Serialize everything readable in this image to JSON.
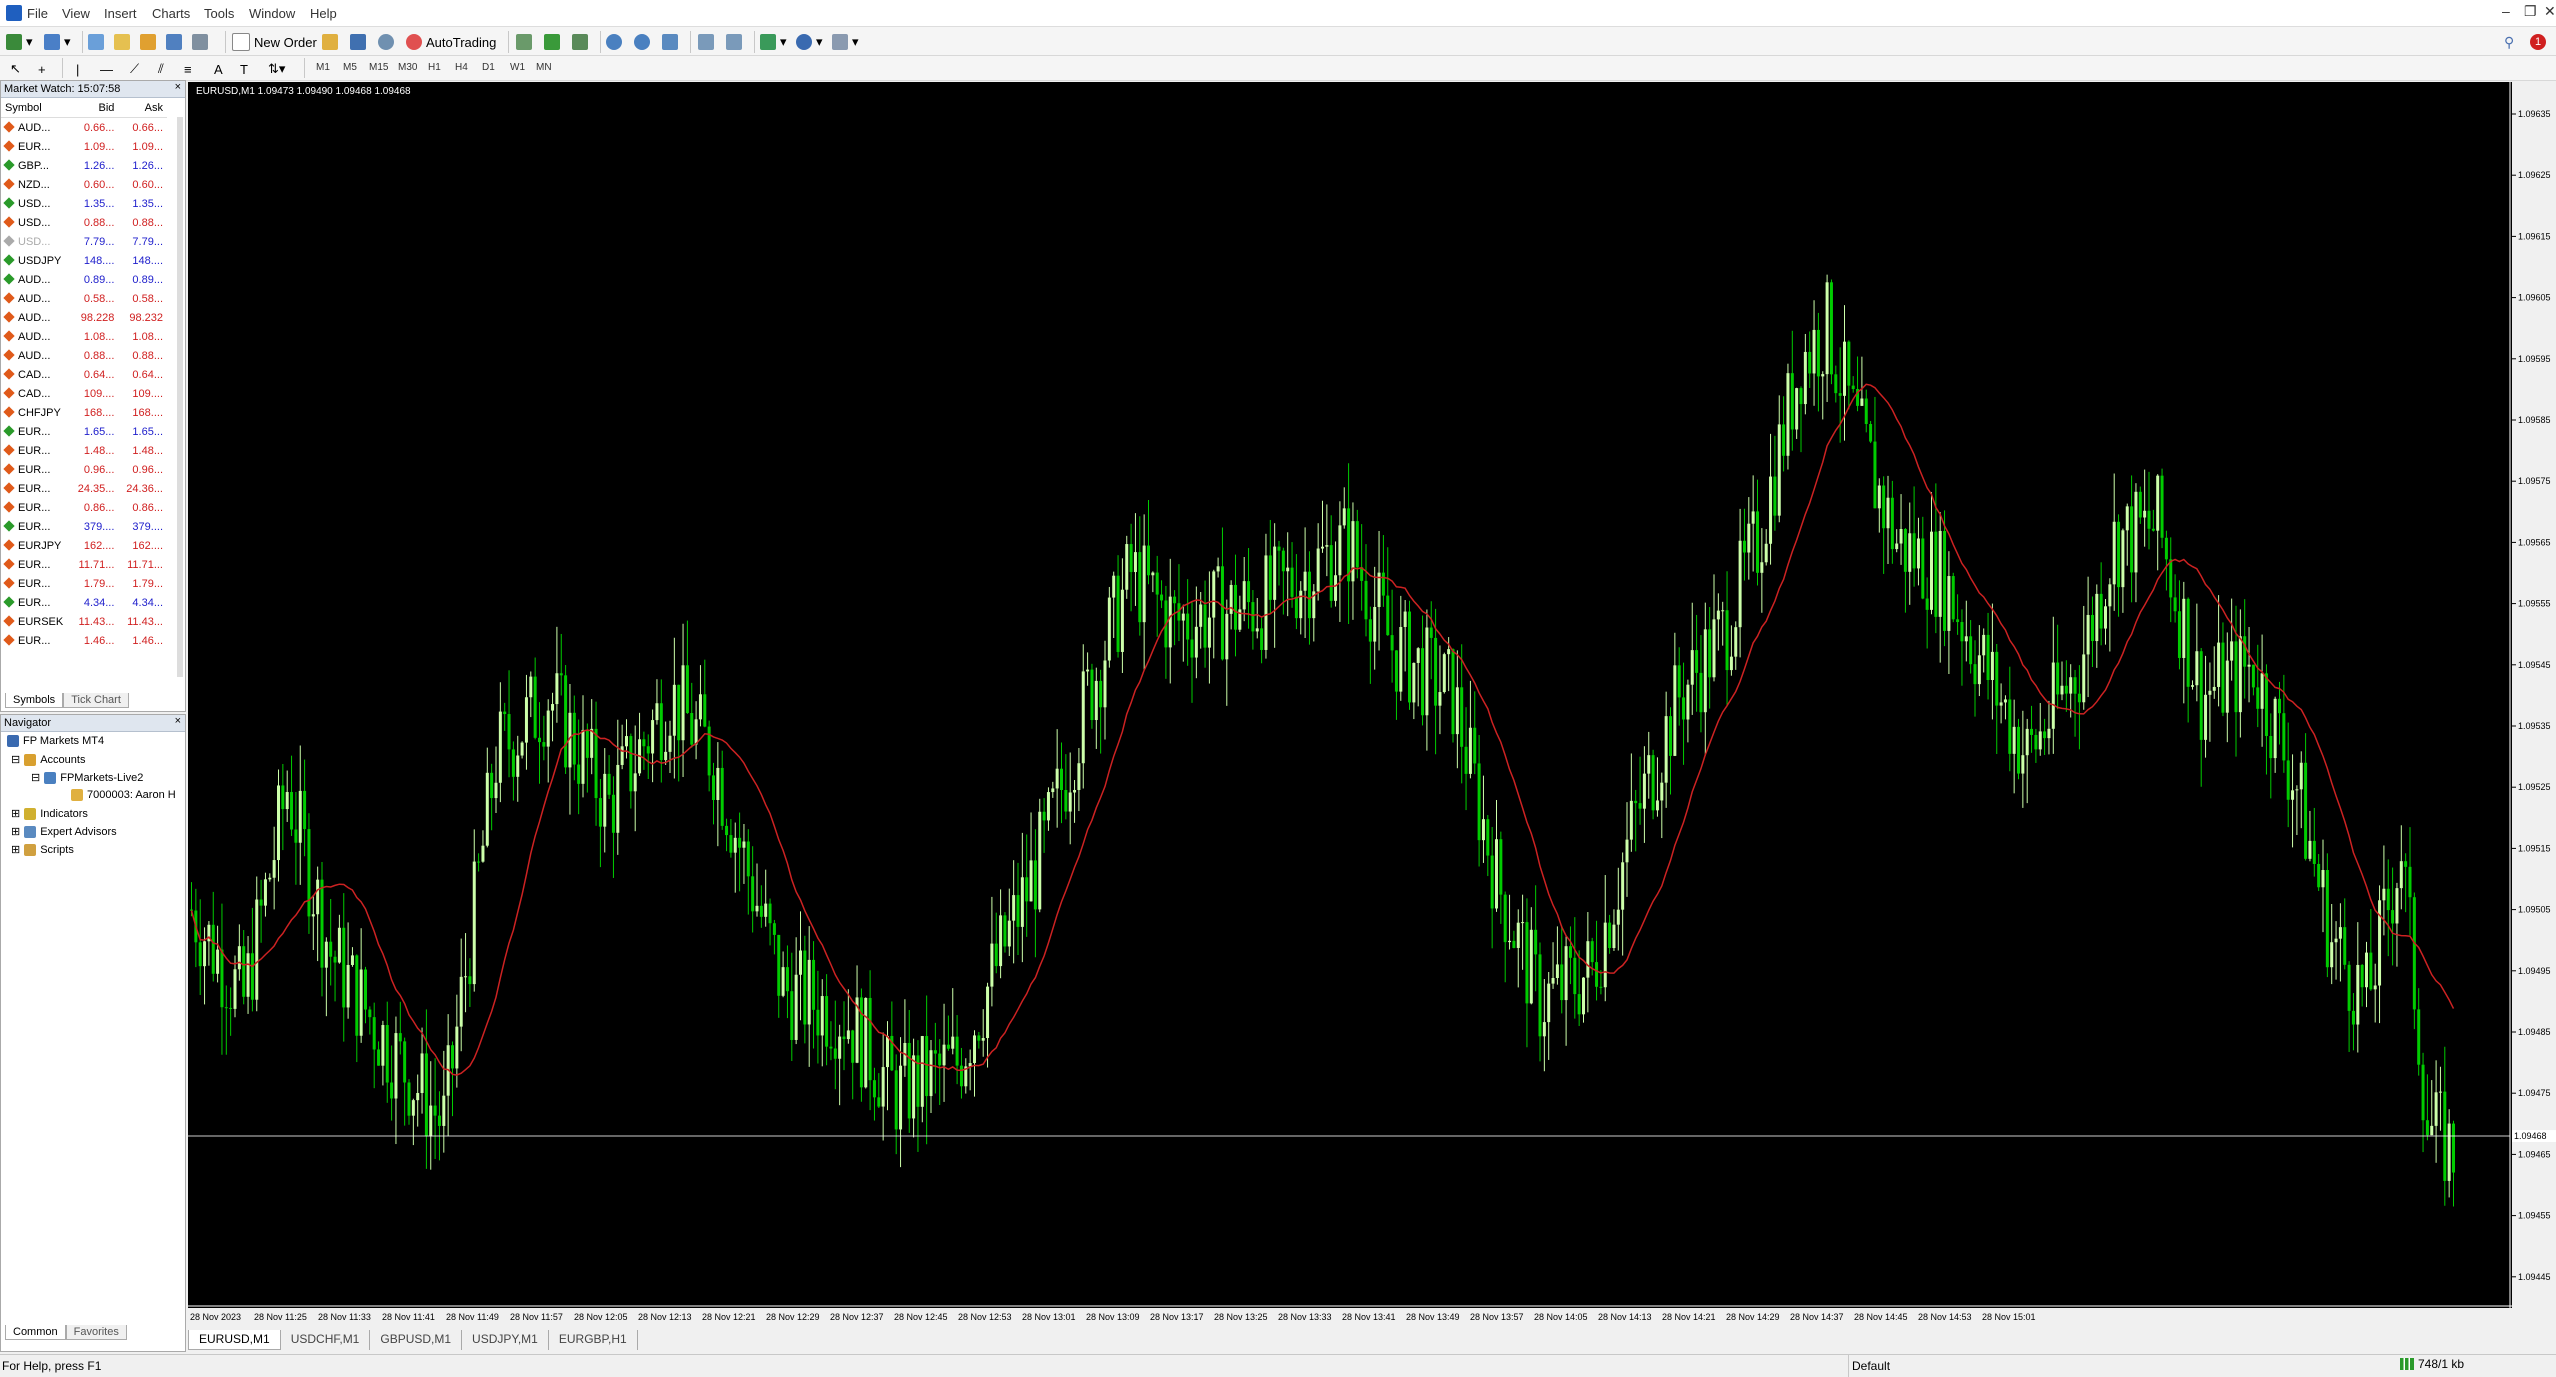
{
  "menubar": {
    "items": [
      "File",
      "View",
      "Insert",
      "Charts",
      "Tools",
      "Window",
      "Help"
    ],
    "notification_count": "1"
  },
  "toolbar": {
    "new_order_label": "New Order",
    "autotrading_label": "AutoTrading",
    "timeframes": [
      "M1",
      "M5",
      "M15",
      "M30",
      "H1",
      "H4",
      "D1",
      "W1",
      "MN"
    ]
  },
  "market_watch": {
    "title": "Market Watch: 15:07:58",
    "columns": [
      "Symbol",
      "Bid",
      "Ask"
    ],
    "rows": [
      {
        "symbol": "AUD...",
        "bid": "0.66...",
        "ask": "0.66...",
        "dir": "down"
      },
      {
        "symbol": "EUR...",
        "bid": "1.09...",
        "ask": "1.09...",
        "dir": "down"
      },
      {
        "symbol": "GBP...",
        "bid": "1.26...",
        "ask": "1.26...",
        "dir": "up"
      },
      {
        "symbol": "NZD...",
        "bid": "0.60...",
        "ask": "0.60...",
        "dir": "down"
      },
      {
        "symbol": "USD...",
        "bid": "1.35...",
        "ask": "1.35...",
        "dir": "up"
      },
      {
        "symbol": "USD...",
        "bid": "0.88...",
        "ask": "0.88...",
        "dir": "down"
      },
      {
        "symbol": "USD...",
        "bid": "7.79...",
        "ask": "7.79...",
        "dir": "gray"
      },
      {
        "symbol": "USDJPY",
        "bid": "148....",
        "ask": "148....",
        "dir": "up"
      },
      {
        "symbol": "AUD...",
        "bid": "0.89...",
        "ask": "0.89...",
        "dir": "up"
      },
      {
        "symbol": "AUD...",
        "bid": "0.58...",
        "ask": "0.58...",
        "dir": "down"
      },
      {
        "symbol": "AUD...",
        "bid": "98.228",
        "ask": "98.232",
        "dir": "down"
      },
      {
        "symbol": "AUD...",
        "bid": "1.08...",
        "ask": "1.08...",
        "dir": "down"
      },
      {
        "symbol": "AUD...",
        "bid": "0.88...",
        "ask": "0.88...",
        "dir": "down"
      },
      {
        "symbol": "CAD...",
        "bid": "0.64...",
        "ask": "0.64...",
        "dir": "down"
      },
      {
        "symbol": "CAD...",
        "bid": "109....",
        "ask": "109....",
        "dir": "down"
      },
      {
        "symbol": "CHFJPY",
        "bid": "168....",
        "ask": "168....",
        "dir": "down"
      },
      {
        "symbol": "EUR...",
        "bid": "1.65...",
        "ask": "1.65...",
        "dir": "up"
      },
      {
        "symbol": "EUR...",
        "bid": "1.48...",
        "ask": "1.48...",
        "dir": "down"
      },
      {
        "symbol": "EUR...",
        "bid": "0.96...",
        "ask": "0.96...",
        "dir": "down"
      },
      {
        "symbol": "EUR...",
        "bid": "24.35...",
        "ask": "24.36...",
        "dir": "down"
      },
      {
        "symbol": "EUR...",
        "bid": "0.86...",
        "ask": "0.86...",
        "dir": "down"
      },
      {
        "symbol": "EUR...",
        "bid": "379....",
        "ask": "379....",
        "dir": "up"
      },
      {
        "symbol": "EURJPY",
        "bid": "162....",
        "ask": "162....",
        "dir": "down"
      },
      {
        "symbol": "EUR...",
        "bid": "11.71...",
        "ask": "11.71...",
        "dir": "down"
      },
      {
        "symbol": "EUR...",
        "bid": "1.79...",
        "ask": "1.79...",
        "dir": "down"
      },
      {
        "symbol": "EUR...",
        "bid": "4.34...",
        "ask": "4.34...",
        "dir": "up"
      },
      {
        "symbol": "EURSEK",
        "bid": "11.43...",
        "ask": "11.43...",
        "dir": "down"
      },
      {
        "symbol": "EUR...",
        "bid": "1.46...",
        "ask": "1.46...",
        "dir": "down"
      }
    ],
    "tabs": [
      "Symbols",
      "Tick Chart"
    ]
  },
  "navigator": {
    "title": "Navigator",
    "root": "FP Markets MT4",
    "accounts": "Accounts",
    "server": "FPMarkets-Live2",
    "account": "7000003: Aaron H",
    "indicators": "Indicators",
    "experts": "Expert Advisors",
    "scripts": "Scripts",
    "tabs": [
      "Common",
      "Favorites"
    ]
  },
  "chart": {
    "header": "EURUSD,M1  1.09473 1.09490 1.09468 1.09468",
    "current_price": "1.09468",
    "colors": {
      "bg": "#000000",
      "bull": "#ccffaa",
      "bear": "#00cc00",
      "ma": "#cc2222",
      "grid_text": "#ffffff"
    },
    "price_labels": [
      "1.09635",
      "1.09625",
      "1.09615",
      "1.09605",
      "1.09595",
      "1.09585",
      "1.09575",
      "1.09565",
      "1.09555",
      "1.09545",
      "1.09535",
      "1.09525",
      "1.09515",
      "1.09505",
      "1.09495",
      "1.09485",
      "1.09475",
      "1.09465",
      "1.09455",
      "1.09445"
    ],
    "time_labels": [
      "28 Nov 2023",
      "28 Nov 11:25",
      "28 Nov 11:33",
      "28 Nov 11:41",
      "28 Nov 11:49",
      "28 Nov 11:57",
      "28 Nov 12:05",
      "28 Nov 12:13",
      "28 Nov 12:21",
      "28 Nov 12:29",
      "28 Nov 12:37",
      "28 Nov 12:45",
      "28 Nov 12:53",
      "28 Nov 13:01",
      "28 Nov 13:09",
      "28 Nov 13:17",
      "28 Nov 13:25",
      "28 Nov 13:33",
      "28 Nov 13:41",
      "28 Nov 13:49",
      "28 Nov 13:57",
      "28 Nov 14:05",
      "28 Nov 14:13",
      "28 Nov 14:21",
      "28 Nov 14:29",
      "28 Nov 14:37",
      "28 Nov 14:45",
      "28 Nov 14:53",
      "28 Nov 15:01"
    ]
  },
  "chart_tabs": [
    "EURUSD,M1",
    "USDCHF,M1",
    "GBPUSD,M1",
    "USDJPY,M1",
    "EURGBP,H1"
  ],
  "status": {
    "help": "For Help, press F1",
    "profile": "Default",
    "traffic": "748/1 kb"
  }
}
